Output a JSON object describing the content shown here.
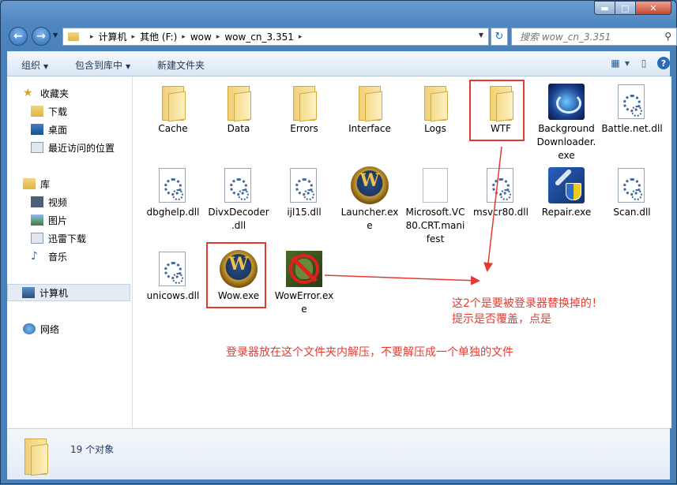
{
  "window": {
    "minimize_glyph": "▬",
    "maximize_glyph": "□",
    "close_glyph": "✕"
  },
  "nav": {
    "back_glyph": "←",
    "forward_glyph": "→"
  },
  "address": {
    "crumbs": [
      "计算机",
      "其他 (F:)",
      "wow",
      "wow_cn_3.351"
    ],
    "separator": "▸"
  },
  "search": {
    "placeholder": "搜索 wow_cn_3.351"
  },
  "toolbar": {
    "organize": "组织",
    "include_in_library": "包含到库中",
    "new_folder": "新建文件夹"
  },
  "sidebar": {
    "favorites": "收藏夹",
    "downloads": "下载",
    "desktop": "桌面",
    "recent": "最近访问的位置",
    "libraries": "库",
    "videos": "视频",
    "pictures": "图片",
    "thunder": "迅雷下载",
    "music": "音乐",
    "computer": "计算机",
    "network": "网络"
  },
  "files": [
    {
      "name": "Cache",
      "icon": "folder-icon"
    },
    {
      "name": "Data",
      "icon": "folder-icon"
    },
    {
      "name": "Errors",
      "icon": "folder-icon"
    },
    {
      "name": "Interface",
      "icon": "folder-icon"
    },
    {
      "name": "Logs",
      "icon": "folder-icon"
    },
    {
      "name": "WTF",
      "icon": "folder-icon"
    },
    {
      "name": "BackgroundDownloader.exe",
      "icon": "background-downloader-icon"
    },
    {
      "name": "Battle.net.dll",
      "icon": "dll-icon"
    },
    {
      "name": "dbghelp.dll",
      "icon": "dll-icon"
    },
    {
      "name": "DivxDecoder.dll",
      "icon": "dll-icon"
    },
    {
      "name": "ijl15.dll",
      "icon": "dll-icon"
    },
    {
      "name": "Launcher.exe",
      "icon": "wow-logo-icon"
    },
    {
      "name": "Microsoft.VC80.CRT.manifest",
      "icon": "manifest-file-icon"
    },
    {
      "name": "msvcr80.dll",
      "icon": "dll-icon"
    },
    {
      "name": "Repair.exe",
      "icon": "repair-icon"
    },
    {
      "name": "Scan.dll",
      "icon": "dll-icon"
    },
    {
      "name": "unicows.dll",
      "icon": "dll-icon"
    },
    {
      "name": "Wow.exe",
      "icon": "wow-logo-icon"
    },
    {
      "name": "WowError.exe",
      "icon": "wow-error-icon"
    }
  ],
  "annotations": {
    "replace_note_line1": "这2个是要被登录器替换掉的！",
    "replace_note_line2": "提示是否覆盖，点是",
    "extract_note": "登录器放在这个文件夹内解压，不要解压成一个单独的文件",
    "color": "#e53a32"
  },
  "status": {
    "count": "19 个对象"
  }
}
